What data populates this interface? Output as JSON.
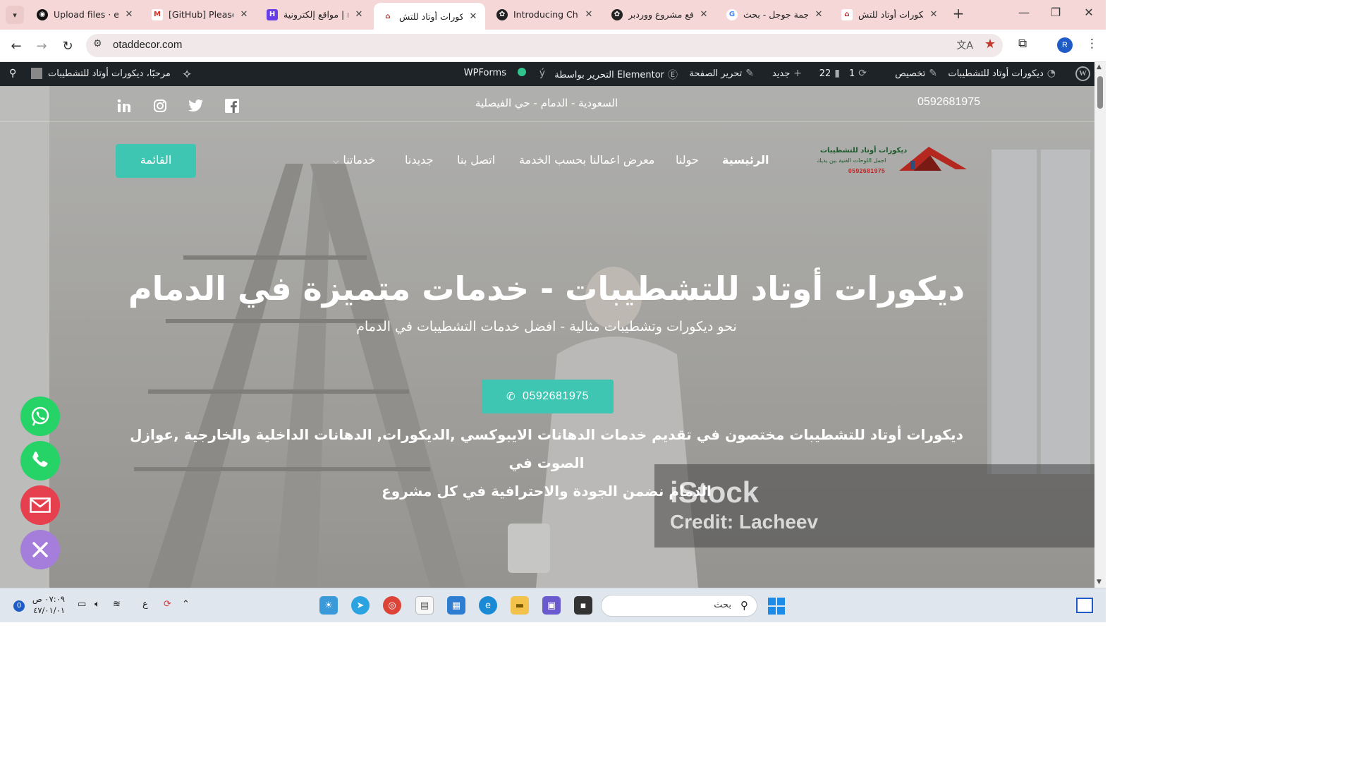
{
  "browser": {
    "tabs": [
      {
        "title": "Upload files · eng",
        "icon": "github-icon",
        "color": "#111111"
      },
      {
        "title": "[GitHub] Please v",
        "icon": "gmail-icon",
        "color": "#d93025"
      },
      {
        "title": "مواقع إلكترونية | r",
        "icon": "hostinger-icon",
        "color": "#673de6"
      },
      {
        "title": "ديكورات أوتاد للتش",
        "icon": "site-logo-icon",
        "color": "#b22222",
        "active": true
      },
      {
        "title": "Introducing Chat",
        "icon": "openai-icon",
        "color": "#222222"
      },
      {
        "title": "رفع مشروع ووردبر",
        "icon": "openai-icon",
        "color": "#222222"
      },
      {
        "title": "ترجمة جوجل - بحث",
        "icon": "google-icon",
        "color": "#4285f4"
      },
      {
        "title": "ديكورات أوتاد للتش",
        "icon": "site-logo-icon",
        "color": "#b22222"
      }
    ],
    "url": "otaddecor.com",
    "profile_initial": "R"
  },
  "wp_admin": {
    "site_name": "ديكورات أوتاد للتشطيبات",
    "customize": "تخصيص",
    "updates": "1",
    "comments": "22",
    "new": "جديد",
    "edit_page": "تحرير الصفحة",
    "elementor": "التحرير بواسطة Elementor",
    "wpforms": "WPForms",
    "greeting": "مرحبًا، ديكورات أوتاد للتشطيبات"
  },
  "site": {
    "topbar": {
      "phone": "0592681975",
      "location": "السعودية - الدمام - حي الفيصلية"
    },
    "logo": {
      "line1": "ديكورات أوتاد للتشطيبات",
      "line2": "اجمل اللوحات الفنية بين يديك",
      "line3": "0592681975"
    },
    "nav": {
      "home": "الرئيسية",
      "about": "حولنا",
      "gallery": "معرض اعمالنا بحسب الخدمة",
      "contact": "اتصل بنا",
      "new": "جديدنا",
      "services": "خدماتنا"
    },
    "menu_button": "القائمة",
    "hero": {
      "title": "ديكورات أوتاد للتشطيبات - خدمات متميزة في الدمام",
      "subtitle": "نحو ديكورات وتشطيبات مثالية - افضل خدمات التشطيبات في الدمام",
      "cta_phone": "0592681975",
      "desc_line1": "ديكورات أوتاد للتشطيبات مختصون في تقديم خدمات الدهانات الايبوكسي ,الديكورات, الدهانات الداخلية والخارجية ,عوازل الصوت في",
      "desc_line2": "الدمام نضمن الجودة والاحترافية في كل مشروع"
    },
    "watermark": {
      "brand": "iStock",
      "credit": "Credit: Lacheev"
    },
    "colors": {
      "accent": "#3ec6b3",
      "whatsapp": "#25d366",
      "email": "#e6404f",
      "close": "#a57ddb"
    }
  },
  "taskbar": {
    "search_placeholder": "بحث",
    "time": "٠٧:٠٩ ص",
    "date": "٤٧/٠١/٠١",
    "lang": "ع",
    "notifications": "0"
  }
}
